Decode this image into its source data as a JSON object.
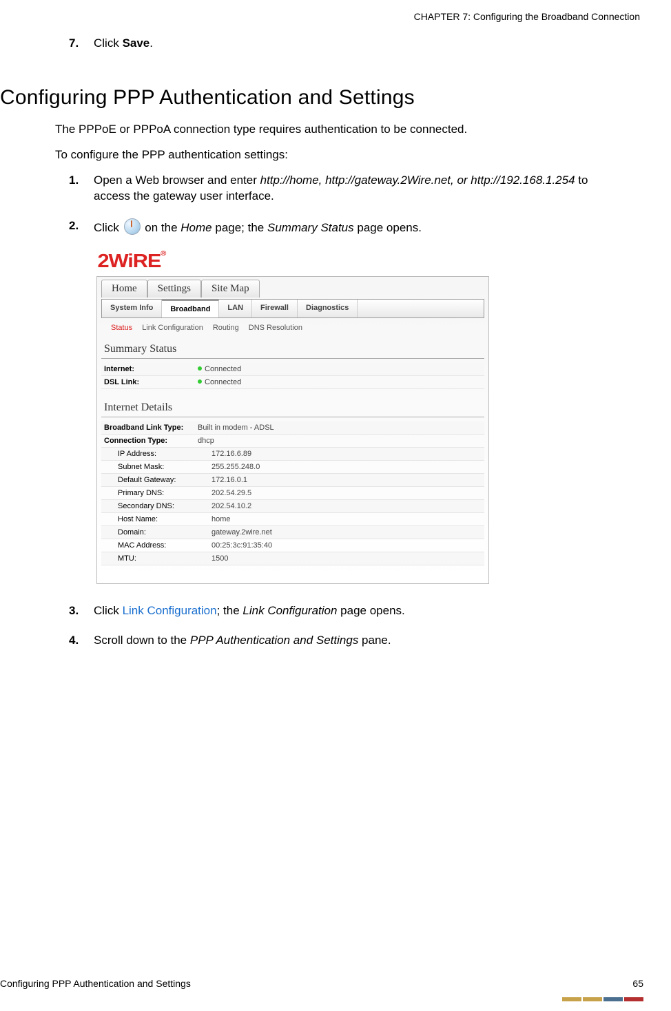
{
  "header": {
    "chapter": "CHAPTER 7: Configuring the Broadband Connection"
  },
  "top_step": {
    "num": "7.",
    "pre": "Click ",
    "bold": "Save",
    "post": "."
  },
  "section_title": "Configuring PPP Authentication and Settings",
  "intro1": "The PPPoE or PPPoA connection type requires authentication to be connected.",
  "intro2": "To configure the PPP authentication settings:",
  "steps": [
    {
      "num": "1.",
      "t1": "Open a Web browser and enter ",
      "it": "http://home, http://gateway.2Wire.net, or http://192.168.1.254",
      "t2": " to access the gateway user interface."
    },
    {
      "num": "2.",
      "t1": "Click ",
      "icon": true,
      "t2": " on the ",
      "it2": "Home",
      "t3": " page; the ",
      "it3": "Summary Status",
      "t4": " page opens."
    }
  ],
  "after_steps": [
    {
      "num": "3.",
      "t1": "Click ",
      "link": "Link Configuration",
      "t2": "; the ",
      "it": "Link Configuration",
      "t3": " page opens."
    },
    {
      "num": "4.",
      "t1": "Scroll down to the ",
      "it": "PPP Authentication and Settings",
      "t2": " pane."
    }
  ],
  "shot": {
    "logo": "2WiRE",
    "reg": "®",
    "toptabs": [
      "Home",
      "Settings",
      "Site Map"
    ],
    "subtabs": [
      "System Info",
      "Broadband",
      "LAN",
      "Firewall",
      "Diagnostics"
    ],
    "active_subtab": 1,
    "sublinks": [
      "Status",
      "Link Configuration",
      "Routing",
      "DNS Resolution"
    ],
    "active_sublink": 0,
    "summary_title": "Summary Status",
    "summary_rows": [
      {
        "label": "Internet:",
        "val": "Connected",
        "bold": true,
        "dot": true
      },
      {
        "label": "DSL Link:",
        "val": "Connected",
        "bold": true,
        "dot": true
      }
    ],
    "details_title": "Internet Details",
    "details_rows": [
      {
        "label": "Broadband Link Type:",
        "val": "Built in modem - ADSL",
        "bold": true
      },
      {
        "label": "Connection Type:",
        "val": "dhcp",
        "bold": true
      },
      {
        "label": "IP Address:",
        "val": "172.16.6.89",
        "indent": true
      },
      {
        "label": "Subnet Mask:",
        "val": "255.255.248.0",
        "indent": true
      },
      {
        "label": "Default Gateway:",
        "val": "172.16.0.1",
        "indent": true
      },
      {
        "label": "Primary DNS:",
        "val": "202.54.29.5",
        "indent": true
      },
      {
        "label": "Secondary DNS:",
        "val": "202.54.10.2",
        "indent": true
      },
      {
        "label": "Host Name:",
        "val": "home",
        "indent": true
      },
      {
        "label": "Domain:",
        "val": "gateway.2wire.net",
        "indent": true
      },
      {
        "label": "MAC Address:",
        "val": "00:25:3c:91:35:40",
        "indent": true
      },
      {
        "label": "MTU:",
        "val": "1500",
        "indent": true
      }
    ]
  },
  "footer": {
    "left": "Configuring PPP Authentication and Settings",
    "right": "65"
  },
  "bar_colors": [
    "#c7a24a",
    "#c7a24a",
    "#4b6f8f",
    "#b43030"
  ]
}
